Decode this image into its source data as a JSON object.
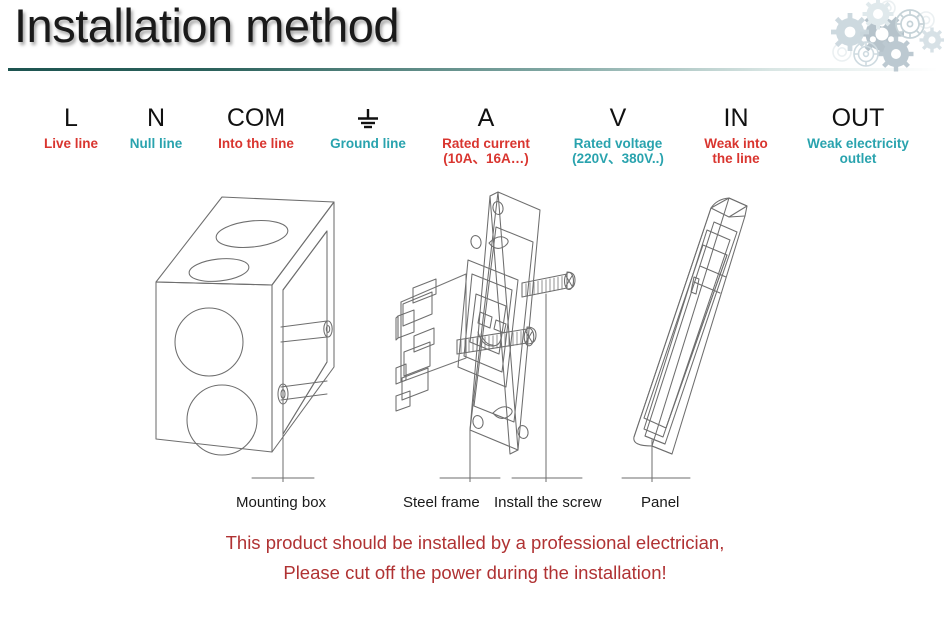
{
  "header": {
    "title": "Installation method",
    "decoration_icon": "gears-icon",
    "rule_color": "#1d5450"
  },
  "legend": {
    "colors": {
      "red": "#d9352f",
      "teal": "#29a3ae",
      "symbol": "#111111"
    },
    "items": [
      {
        "symbol": "L",
        "symbol_kind": "text",
        "description": "Live line",
        "color": "red",
        "name": "live-line"
      },
      {
        "symbol": "N",
        "symbol_kind": "text",
        "description": "Null line",
        "color": "teal",
        "name": "null-line"
      },
      {
        "symbol": "COM",
        "symbol_kind": "text",
        "description": "Into the line",
        "color": "red",
        "name": "com-into-the-line"
      },
      {
        "symbol": "",
        "symbol_kind": "ground",
        "description": "Ground line",
        "color": "teal",
        "name": "ground-line"
      },
      {
        "symbol": "A",
        "symbol_kind": "text",
        "description": "Rated current\n(10A、16A…)",
        "color": "red",
        "name": "rated-current"
      },
      {
        "symbol": "V",
        "symbol_kind": "text",
        "description": "Rated voltage\n(220V、380V..)",
        "color": "teal",
        "name": "rated-voltage"
      },
      {
        "symbol": "IN",
        "symbol_kind": "text",
        "description": "Weak into\nthe line",
        "color": "red",
        "name": "weak-into-the-line"
      },
      {
        "symbol": "OUT",
        "symbol_kind": "text",
        "description": "Weak electricity\noutlet",
        "color": "teal",
        "name": "weak-electricity-outlet"
      }
    ]
  },
  "diagram": {
    "parts": [
      {
        "name": "mounting-box",
        "label": "Mounting box"
      },
      {
        "name": "steel-frame",
        "label": "Steel frame"
      },
      {
        "name": "install-the-screw",
        "label": "Install the screw"
      },
      {
        "name": "panel",
        "label": "Panel"
      }
    ],
    "line_color": "#6e6e6e"
  },
  "warning": {
    "color": "#b03233",
    "lines": [
      "This product should be installed by a professional electrician,",
      "Please cut off the power during the installation!"
    ]
  }
}
